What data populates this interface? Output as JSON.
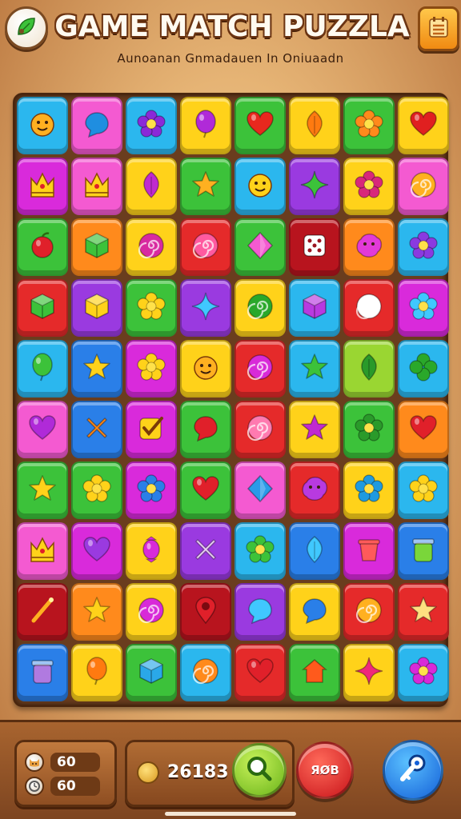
{
  "header": {
    "title": "GAME MATCH PUZZLA",
    "subtitle": "Aunoanan Gnmadauen In Oniuaadn",
    "left_icon": "leaf-logo-icon",
    "right_icon": "menu-list-icon"
  },
  "colors": {
    "cyan": "#2bb7ee",
    "pink": "#f45ad1",
    "yellow": "#ffd21a",
    "orange": "#ff8a1c",
    "red": "#e52a2a",
    "green": "#3cc23a",
    "purple": "#9a3ae0",
    "blue": "#2a7fe8",
    "lime": "#9ad632",
    "magenta": "#d92adb",
    "darkred": "#b8141e",
    "teal": "#1fb0c8"
  },
  "board": {
    "rows": [
      [
        {
          "bg": "cyan",
          "icon": "smiley",
          "ic": "#ffb020"
        },
        {
          "bg": "pink",
          "icon": "bubble",
          "ic": "#1f8ee0"
        },
        {
          "bg": "cyan",
          "icon": "flower",
          "ic": "#8a2ad8"
        },
        {
          "bg": "yellow",
          "icon": "balloon",
          "ic": "#b02ad8"
        },
        {
          "bg": "green",
          "icon": "heart",
          "ic": "#e8281e"
        },
        {
          "bg": "yellow",
          "icon": "leaf",
          "ic": "#ff7a10"
        },
        {
          "bg": "green",
          "icon": "flower",
          "ic": "#ff8a1c"
        },
        {
          "bg": "yellow",
          "icon": "heart",
          "ic": "#e02020"
        }
      ],
      [
        {
          "bg": "magenta",
          "icon": "crown",
          "ic": "#ffd21a"
        },
        {
          "bg": "pink",
          "icon": "crown",
          "ic": "#ffd21a"
        },
        {
          "bg": "yellow",
          "icon": "leaf",
          "ic": "#c02ad0"
        },
        {
          "bg": "green",
          "icon": "star",
          "ic": "#ffb020"
        },
        {
          "bg": "cyan",
          "icon": "smiley",
          "ic": "#ffd21a"
        },
        {
          "bg": "purple",
          "icon": "sparkle",
          "ic": "#3cc23a"
        },
        {
          "bg": "yellow",
          "icon": "flower",
          "ic": "#d8287a"
        },
        {
          "bg": "pink",
          "icon": "swirl",
          "ic": "#ffb020"
        }
      ],
      [
        {
          "bg": "green",
          "icon": "fruit",
          "ic": "#e0202a"
        },
        {
          "bg": "orange",
          "icon": "cube",
          "ic": "#3cc23a"
        },
        {
          "bg": "yellow",
          "icon": "swirl",
          "ic": "#d82aa0"
        },
        {
          "bg": "red",
          "icon": "swirl",
          "ic": "#ff5aa0"
        },
        {
          "bg": "green",
          "icon": "diamond",
          "ic": "#f45ad1"
        },
        {
          "bg": "darkred",
          "icon": "dice",
          "ic": "#ffffff"
        },
        {
          "bg": "orange",
          "icon": "blob",
          "ic": "#e23ad8"
        },
        {
          "bg": "cyan",
          "icon": "flower",
          "ic": "#8a3ae0"
        }
      ],
      [
        {
          "bg": "red",
          "icon": "cube",
          "ic": "#3cc23a"
        },
        {
          "bg": "purple",
          "icon": "cube",
          "ic": "#ffd21a"
        },
        {
          "bg": "green",
          "icon": "flower",
          "ic": "#ffd21a"
        },
        {
          "bg": "purple",
          "icon": "sparkle",
          "ic": "#40c8ff"
        },
        {
          "bg": "yellow",
          "icon": "swirl",
          "ic": "#2aa82a"
        },
        {
          "bg": "cyan",
          "icon": "cube",
          "ic": "#b83ae0"
        },
        {
          "bg": "red",
          "icon": "swirl",
          "ic": "#ffffff"
        },
        {
          "bg": "magenta",
          "icon": "flower",
          "ic": "#40c8ff"
        }
      ],
      [
        {
          "bg": "cyan",
          "icon": "balloon",
          "ic": "#3cc23a"
        },
        {
          "bg": "blue",
          "icon": "star",
          "ic": "#ffd21a"
        },
        {
          "bg": "magenta",
          "icon": "flower",
          "ic": "#ffd21a"
        },
        {
          "bg": "yellow",
          "icon": "smiley",
          "ic": "#ffb020"
        },
        {
          "bg": "red",
          "icon": "swirl",
          "ic": "#d82ad8"
        },
        {
          "bg": "cyan",
          "icon": "star",
          "ic": "#3cc23a"
        },
        {
          "bg": "lime",
          "icon": "leaf",
          "ic": "#2a9a2a"
        },
        {
          "bg": "cyan",
          "icon": "clover",
          "ic": "#2aa82a"
        }
      ],
      [
        {
          "bg": "pink",
          "icon": "heart",
          "ic": "#b02ad8"
        },
        {
          "bg": "blue",
          "icon": "cross",
          "ic": "#ff8a1c"
        },
        {
          "bg": "magenta",
          "icon": "check",
          "ic": "#ffd21a"
        },
        {
          "bg": "green",
          "icon": "bubble",
          "ic": "#e0202a"
        },
        {
          "bg": "red",
          "icon": "swirl",
          "ic": "#ff7ab0"
        },
        {
          "bg": "yellow",
          "icon": "star",
          "ic": "#c02ad0"
        },
        {
          "bg": "green",
          "icon": "flower",
          "ic": "#2a9a2a"
        },
        {
          "bg": "orange",
          "icon": "heart",
          "ic": "#e0202a"
        }
      ],
      [
        {
          "bg": "green",
          "icon": "star",
          "ic": "#ffd21a"
        },
        {
          "bg": "green",
          "icon": "flower",
          "ic": "#ffd21a"
        },
        {
          "bg": "magenta",
          "icon": "flower",
          "ic": "#2a7fe8"
        },
        {
          "bg": "green",
          "icon": "heart",
          "ic": "#e0202a"
        },
        {
          "bg": "pink",
          "icon": "diamond",
          "ic": "#2a9ae8"
        },
        {
          "bg": "red",
          "icon": "blob",
          "ic": "#b83ae0"
        },
        {
          "bg": "yellow",
          "icon": "flower",
          "ic": "#1f9ae0"
        },
        {
          "bg": "cyan",
          "icon": "flower",
          "ic": "#ffd21a"
        }
      ],
      [
        {
          "bg": "pink",
          "icon": "crown",
          "ic": "#ffd21a"
        },
        {
          "bg": "magenta",
          "icon": "heart",
          "ic": "#9a3ae0"
        },
        {
          "bg": "yellow",
          "icon": "candy",
          "ic": "#d82ad8"
        },
        {
          "bg": "purple",
          "icon": "cross",
          "ic": "#f0d0ff"
        },
        {
          "bg": "cyan",
          "icon": "flower",
          "ic": "#3cc23a"
        },
        {
          "bg": "blue",
          "icon": "leaf",
          "ic": "#40c8ff"
        },
        {
          "bg": "magenta",
          "icon": "cup",
          "ic": "#ff5a5a"
        },
        {
          "bg": "blue",
          "icon": "jar",
          "ic": "#7ad63a"
        }
      ],
      [
        {
          "bg": "darkred",
          "icon": "wand",
          "ic": "#ffb020"
        },
        {
          "bg": "orange",
          "icon": "star",
          "ic": "#ffd21a"
        },
        {
          "bg": "yellow",
          "icon": "swirl",
          "ic": "#d82ad8"
        },
        {
          "bg": "darkred",
          "icon": "pin",
          "ic": "#e0202a"
        },
        {
          "bg": "purple",
          "icon": "bubble",
          "ic": "#40c8ff"
        },
        {
          "bg": "yellow",
          "icon": "bubble",
          "ic": "#2a7fe8"
        },
        {
          "bg": "red",
          "icon": "swirl",
          "ic": "#ffb020"
        },
        {
          "bg": "red",
          "icon": "star",
          "ic": "#ffe080"
        }
      ],
      [
        {
          "bg": "blue",
          "icon": "jar",
          "ic": "#b07ae0"
        },
        {
          "bg": "yellow",
          "icon": "balloon",
          "ic": "#ff7a10"
        },
        {
          "bg": "green",
          "icon": "cube",
          "ic": "#2aa8e8"
        },
        {
          "bg": "cyan",
          "icon": "swirl",
          "ic": "#ff8a1c"
        },
        {
          "bg": "red",
          "icon": "heart",
          "ic": "#e0202a"
        },
        {
          "bg": "green",
          "icon": "house",
          "ic": "#ff5a1c"
        },
        {
          "bg": "yellow",
          "icon": "sparkle",
          "ic": "#f0287a"
        },
        {
          "bg": "cyan",
          "icon": "flower",
          "ic": "#d82ad8"
        }
      ]
    ]
  },
  "bottom": {
    "moves_value": "60",
    "moves_icon": "cat-face-icon",
    "time_value": "60",
    "time_icon": "clock-icon",
    "score_value": "26183",
    "score_icon": "coin-icon",
    "search_icon": "magnifier-icon",
    "shuffle_label": "ЯØB",
    "key_icon": "key-icon"
  }
}
